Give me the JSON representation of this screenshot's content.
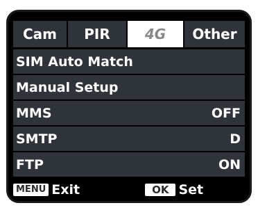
{
  "tabs": [
    {
      "label": "Cam",
      "active": false
    },
    {
      "label": "PIR",
      "active": false
    },
    {
      "label": "4G",
      "active": true
    },
    {
      "label": "Other",
      "active": false
    }
  ],
  "menu": {
    "items": [
      {
        "label": "SIM Auto Match",
        "value": ""
      },
      {
        "label": "Manual Setup",
        "value": ""
      },
      {
        "label": "MMS",
        "value": "OFF"
      },
      {
        "label": "SMTP",
        "value": "D"
      },
      {
        "label": "FTP",
        "value": "ON"
      }
    ]
  },
  "footer": {
    "menu_key": "MENU",
    "menu_action": "Exit",
    "ok_key": "OK",
    "ok_action": "Set"
  },
  "colors": {
    "screen_bg": "#000000",
    "row_bg": "#2f343a",
    "active_tab_bg": "#ffffff",
    "active_tab_text": "#888888",
    "text": "#ffffff"
  }
}
